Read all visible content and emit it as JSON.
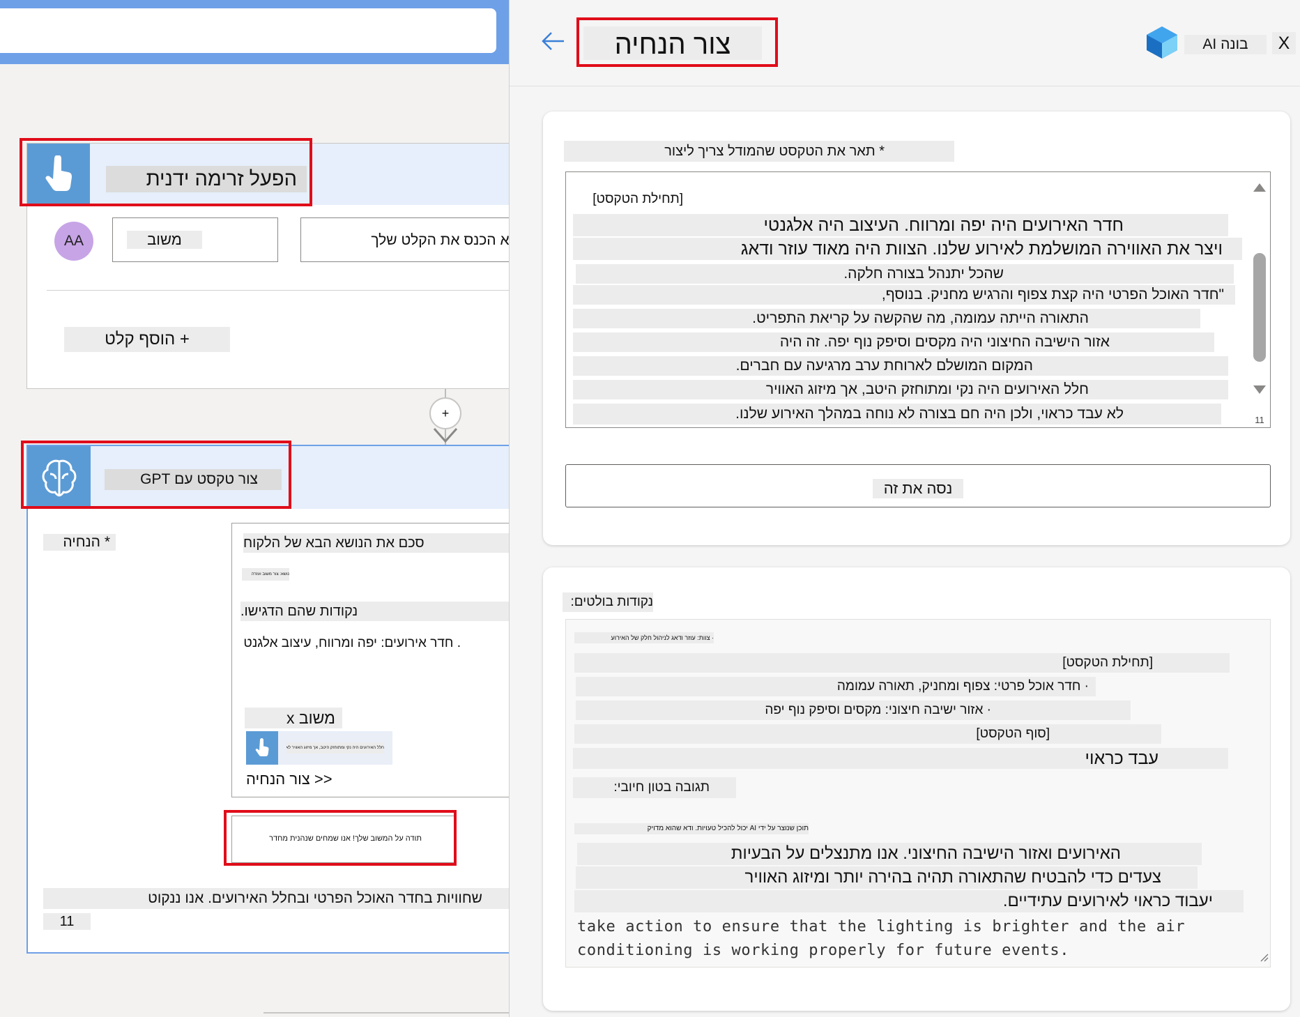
{
  "colors": {
    "accent": "#5b9bd5",
    "highlight": "#e00d1a",
    "avatar": "#c7a4e6"
  },
  "flow": {
    "trigger": {
      "title": "הפעל זרימה ידנית",
      "icon": "touch-hand-icon",
      "avatar": "AA",
      "input_type": "משוב",
      "input_placeholder": "אנא הכנס את הקלט שלך",
      "add_input": "+ הוסף קלט"
    },
    "add_step": "+",
    "gpt": {
      "title": "צור טקסט עם GPT",
      "icon": "brain-icon",
      "prompt_label": "* הנחיה",
      "prompt_line1": "סכם את הנושא הבא של הלקוח",
      "prompt_tiny": "נושא: צור משוב ועזרה",
      "prompt_line2": "נקודות שהם הדגישו.",
      "prompt_line3": ". חדר אירועים: יפה ומרווח, עיצוב אלגנטי",
      "feedback_chip": "משוב x",
      "token_tiny": "חלל האירועים היה נקי ומתוחזק היטב, אך מיזוג האוויר לא",
      "create_prompt": "<< צור הנחיה",
      "sample_text": "תודה על המשוב שלך! אנו שמחים שנהנית מחדר",
      "bottom_line": "שחוויות בחדר האוכל הפרטי ובחלל האירועים. אנו ננקוט",
      "counter": "11"
    }
  },
  "panel": {
    "title": "צור הנחיה",
    "app_name": "בונה AI",
    "close": "X",
    "back_icon": "arrow-left-icon",
    "logo_icon": "ai-builder-logo-icon",
    "describe_label": "* תאר את הטקסט שהמודל צריך ליצור",
    "textarea_lines": [
      "[תחילת הטקסט]",
      "חדר האירועים היה יפה ומרווח. העיצוב היה אלגנטי",
      "ויצר את האווירה המושלמת לאירוע שלנו. הצוות היה מאוד עוזר ודאג",
      "שהכל יתנהל בצורה חלקה.",
      "\"חדר האוכל הפרטי היה קצת צפוף והרגיש מחניק. בנוסף,",
      "התאורה הייתה עמומה, מה שהקשה על קריאת התפריט.",
      "אזור הישיבה החיצוני היה מקסים וסיפק נוף יפה. זה היה",
      "המקום המושלם לארוחת ערב מרגיעה עם חברים.",
      "חלל האירועים היה נקי ומתוחזק היטב, אך מיזוג האוויר",
      "לא עבד כראוי, ולכן היה חם בצורה לא נוחה במהלך האירוע שלנו."
    ],
    "textarea_counter": "11",
    "try_button": "נסה את זה",
    "output_label": "נקודות בולטים:",
    "output_tiny_top": "· צוות: עוזר ודאג לניהול חלק של האירוע",
    "output_lines": [
      "[תחילת הטקסט]",
      "· חדר אוכל פרטי: צפוף ומחניק, תאורה עמומה",
      "· אזור ישיבה חיצוני: מקסים וסיפק נוף יפה",
      "[סוף הטקסט]",
      "עבד כראוי"
    ],
    "positive_tone": "תגובה בטון חיובי:",
    "ai_disclaimer": "תוכן שנוצר על ידי AI יכול להכיל טעויות. ודא שהוא מדויק",
    "response_lines": [
      "האירועים ואזור הישיבה החיצוני. אנו מתנצלים על הבעיות",
      "צעדים כדי להבטיח שהתאורה תהיה בהירה יותר ומיזוג האוויר",
      "יעבוד כראוי לאירועים עתידיים."
    ],
    "response_english": "take action to ensure that the lighting is brighter and the air conditioning is working properly for future events."
  }
}
